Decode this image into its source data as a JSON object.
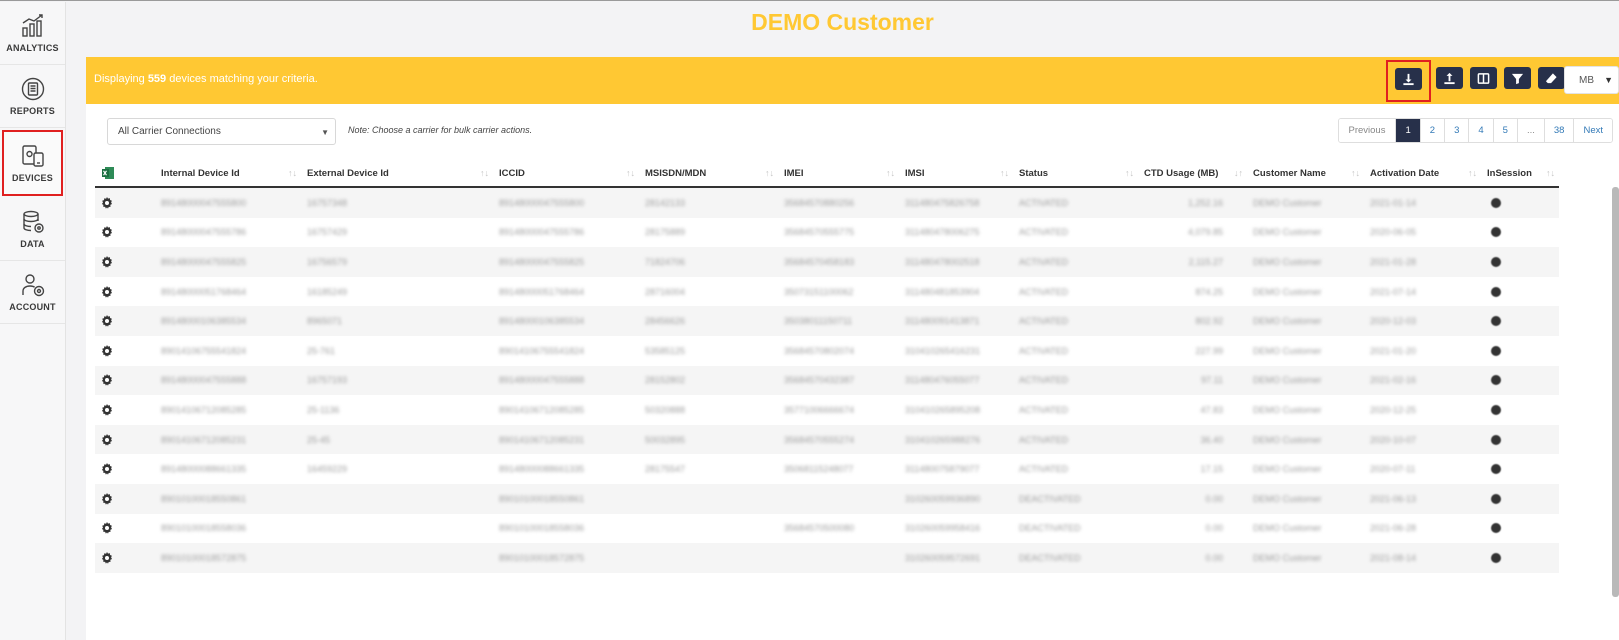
{
  "title": "DEMO Customer",
  "sidebar": {
    "items": [
      {
        "label": "ANALYTICS",
        "icon": "chart-icon"
      },
      {
        "label": "REPORTS",
        "icon": "reports-icon"
      },
      {
        "label": "DEVICES",
        "icon": "devices-icon",
        "active": true
      },
      {
        "label": "DATA",
        "icon": "database-icon"
      },
      {
        "label": "ACCOUNT",
        "icon": "account-icon"
      }
    ]
  },
  "banner": {
    "prefix": "Displaying ",
    "count": "559",
    "suffix": " devices matching your criteria."
  },
  "toolbar": {
    "buttons": [
      "download-icon",
      "upload-icon",
      "columns-icon",
      "filter-icon",
      "eraser-icon"
    ],
    "units_value": "MB"
  },
  "carrier_select": {
    "value": "All Carrier Connections"
  },
  "note": "Note: Choose a carrier for bulk carrier actions.",
  "pager": {
    "previous": "Previous",
    "pages": [
      "1",
      "2",
      "3",
      "4",
      "5",
      "...",
      "38"
    ],
    "current": "1",
    "next": "Next"
  },
  "table": {
    "columns": [
      "",
      "Internal Device Id",
      "External Device Id",
      "ICCID",
      "MSISDN/MDN",
      "IMEI",
      "IMSI",
      "Status",
      "CTD Usage (MB)",
      "Customer Name",
      "Activation Date",
      "InSession"
    ],
    "rows": [
      [
        "89148000047555800",
        "16757348",
        "89148000047555800",
        "28142133",
        "35684570880256",
        "311480475826758",
        "ACTIVATED",
        "1,252.16",
        "DEMO Customer",
        "2021-01-14"
      ],
      [
        "89148000047555786",
        "16757429",
        "89148000047555786",
        "28175889",
        "35684570555775",
        "311480478006275",
        "ACTIVATED",
        "4,079.85",
        "DEMO Customer",
        "2020-06-05"
      ],
      [
        "89148000047555825",
        "16756579",
        "89148000047555825",
        "71824706",
        "35684570458183",
        "311480478002518",
        "ACTIVATED",
        "2,115.27",
        "DEMO Customer",
        "2021-01-28"
      ],
      [
        "89148000051768464",
        "16185249",
        "89148000051768464",
        "28716004",
        "35073151100062",
        "311480481853904",
        "ACTIVATED",
        "874.25",
        "DEMO Customer",
        "2021-07-14"
      ],
      [
        "89148000106385534",
        "8965071",
        "89148000106385534",
        "28456626",
        "35038011150711",
        "311480091413871",
        "ACTIVATED",
        "802.92",
        "DEMO Customer",
        "2020-12-03"
      ],
      [
        "89014106755541824",
        "25-761",
        "89014106755541824",
        "53585125",
        "35684570802074",
        "310410265416231",
        "ACTIVATED",
        "227.99",
        "DEMO Customer",
        "2021-01-20"
      ],
      [
        "89148000047555888",
        "16757193",
        "89148000047555888",
        "28152802",
        "35684570432387",
        "311480476055077",
        "ACTIVATED",
        "97.11",
        "DEMO Customer",
        "2021-02-16"
      ],
      [
        "89014106712085285",
        "25-1136",
        "89014106712085285",
        "50320888",
        "35771006666674",
        "310410265895208",
        "ACTIVATED",
        "47.83",
        "DEMO Customer",
        "2020-12-25"
      ],
      [
        "89014106712085231",
        "25-45",
        "89014106712085231",
        "50032895",
        "35684570555274",
        "310410265988276",
        "ACTIVATED",
        "36.40",
        "DEMO Customer",
        "2020-10-07"
      ],
      [
        "89148000088661335",
        "16459229",
        "89148000088661335",
        "28175547",
        "35068115248077",
        "311480075879077",
        "ACTIVATED",
        "17.15",
        "DEMO Customer",
        "2020-07-11"
      ],
      [
        "89010100018550861",
        "",
        "89010100018550861",
        "",
        "",
        "310260059936890",
        "DEACTIVATED",
        "0.00",
        "DEMO Customer",
        "2021-06-13"
      ],
      [
        "89010100018558036",
        "",
        "89010100018558036",
        "",
        "35684570500080",
        "310260059958416",
        "DEACTIVATED",
        "0.00",
        "DEMO Customer",
        "2021-06-28"
      ],
      [
        "89010100018572875",
        "",
        "89010100018572875",
        "",
        "",
        "310260059572691",
        "DEACTIVATED",
        "0.00",
        "DEMO Customer",
        "2021-08-14"
      ]
    ]
  }
}
